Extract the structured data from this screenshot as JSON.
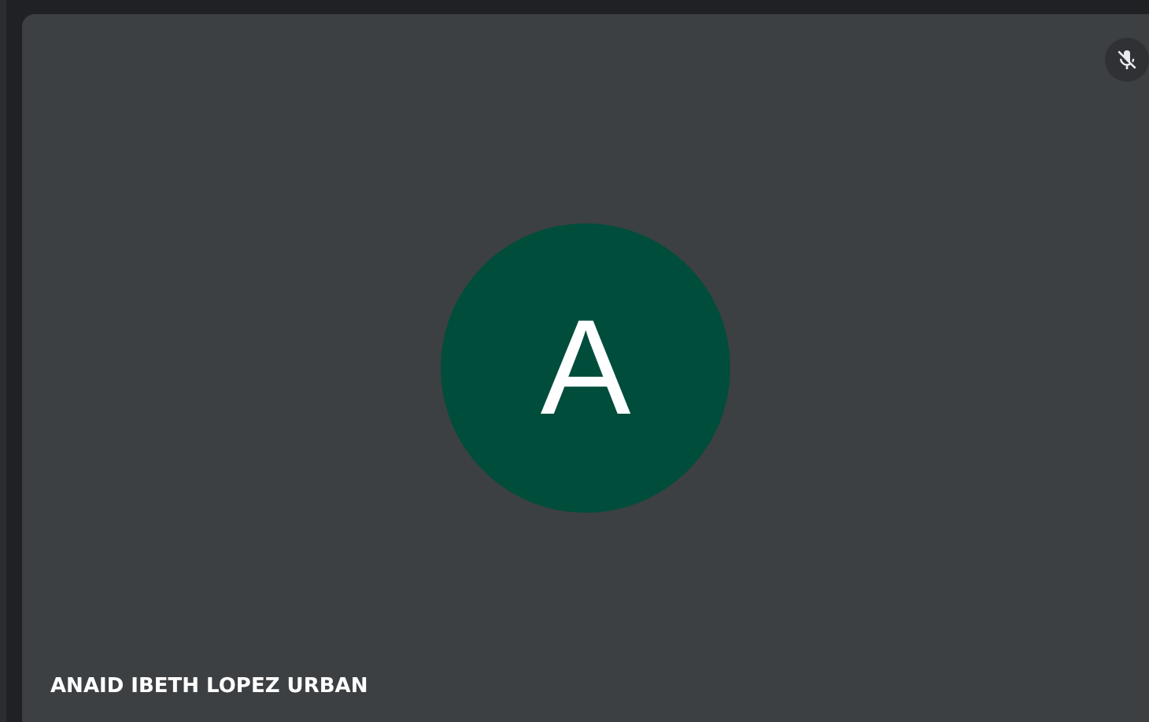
{
  "participant": {
    "name": "ANAID IBETH LOPEZ URBAN",
    "initial": "A",
    "muted": true
  }
}
